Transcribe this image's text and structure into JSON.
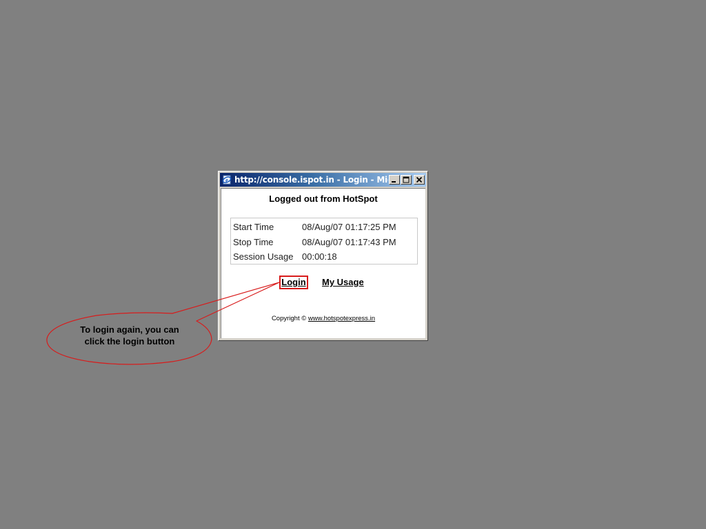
{
  "window": {
    "title": "http://console.ispot.in - Login - Mic...",
    "title_icon": "ie-page-icon",
    "controls": [
      "minimize-icon",
      "maximize-icon",
      "close-icon"
    ]
  },
  "page": {
    "heading": "Logged out from HotSpot",
    "session": [
      {
        "label": "Start Time",
        "value": "08/Aug/07 01:17:25 PM"
      },
      {
        "label": "Stop Time",
        "value": "08/Aug/07 01:17:43 PM"
      },
      {
        "label": "Session Usage",
        "value": "00:00:18"
      }
    ],
    "login_link": "Login",
    "usage_link": "My Usage",
    "copyright_prefix": "Copyright ©",
    "copyright_link": "www.hotspotexpress.in"
  },
  "annotation": {
    "text": "To login again, you can click the login button",
    "color": "#d81b1b"
  },
  "colors": {
    "background": "#808080",
    "highlight": "#d81b1b",
    "titlebar_start": "#0a246a",
    "titlebar_end": "#a6caf0"
  }
}
